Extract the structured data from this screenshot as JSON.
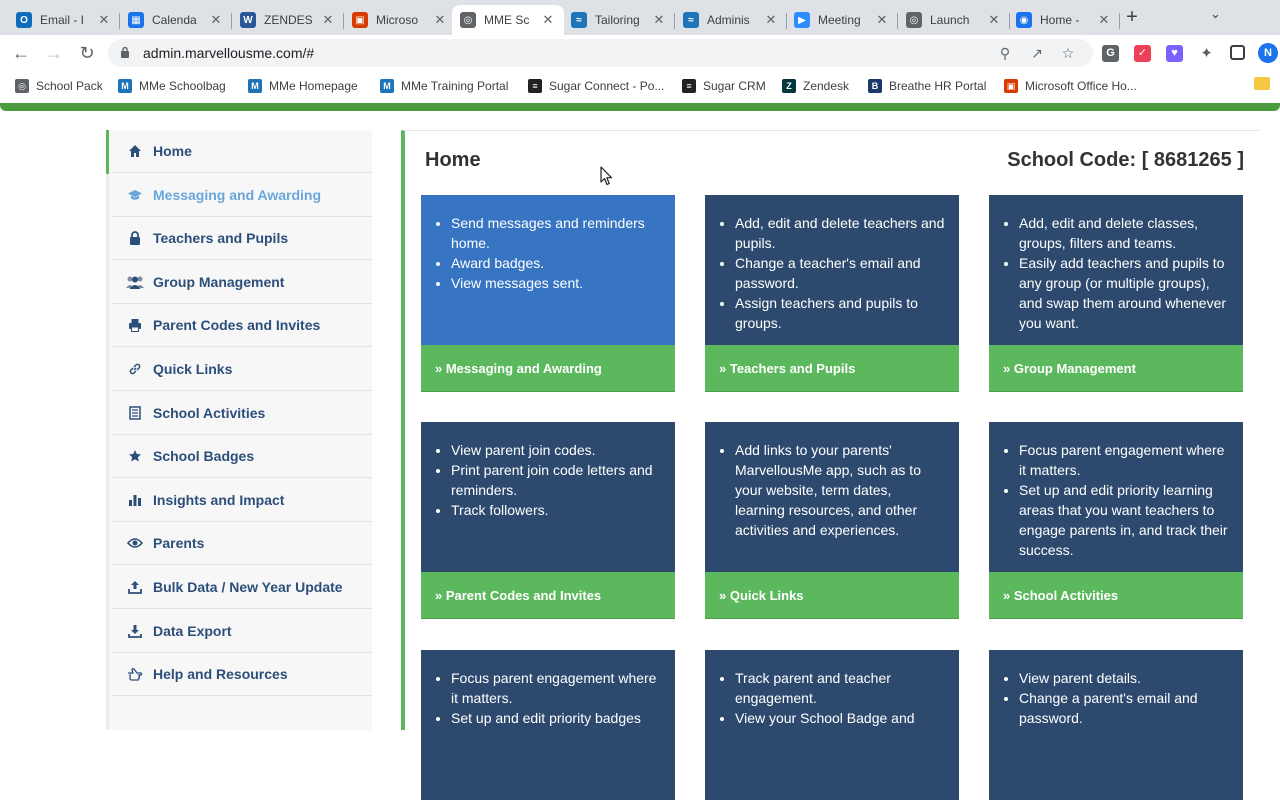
{
  "browser": {
    "tabs": [
      {
        "label": "Email - I",
        "icon": "outlook-icon",
        "color": "#0f6cbd"
      },
      {
        "label": "Calenda",
        "icon": "calendar-icon",
        "color": "#1a73e8"
      },
      {
        "label": "ZENDES",
        "icon": "word-icon",
        "color": "#2b579a"
      },
      {
        "label": "Microso",
        "icon": "office-icon",
        "color": "#d83b01"
      },
      {
        "label": "MME Sc",
        "icon": "globe-icon",
        "color": "#5f6368",
        "active": true
      },
      {
        "label": "Tailoring",
        "icon": "zendesk-guide-icon",
        "color": "#1f73b7"
      },
      {
        "label": "Adminis",
        "icon": "zendesk-guide-icon",
        "color": "#1f73b7"
      },
      {
        "label": "Meeting",
        "icon": "zoom-icon",
        "color": "#2d8cff"
      },
      {
        "label": "Launch",
        "icon": "globe-icon",
        "color": "#5f6368"
      },
      {
        "label": "Home -",
        "icon": "chrome-icon",
        "color": "#1a73e8"
      }
    ],
    "url": "admin.marvellousme.com/#",
    "bookmarks": [
      {
        "label": "School Pack",
        "icon": "globe-icon",
        "color": "#5f6368"
      },
      {
        "label": "MMe Schoolbag",
        "icon": "mme-icon",
        "color": "#1f73b7"
      },
      {
        "label": "MMe Homepage",
        "icon": "mme-icon",
        "color": "#1f73b7"
      },
      {
        "label": "MMe Training Portal",
        "icon": "mme-icon",
        "color": "#1f73b7"
      },
      {
        "label": "Sugar Connect - Po...",
        "icon": "sugar-icon",
        "color": "#222222"
      },
      {
        "label": "Sugar CRM",
        "icon": "sugar-icon",
        "color": "#222222"
      },
      {
        "label": "Zendesk",
        "icon": "zendesk-icon",
        "color": "#03363d"
      },
      {
        "label": "Breathe HR Portal",
        "icon": "breathe-icon",
        "color": "#1b3a6b"
      },
      {
        "label": "Microsoft Office Ho...",
        "icon": "office-icon",
        "color": "#d83b01"
      }
    ],
    "accent_green": "#4b9a3e"
  },
  "sidebar": {
    "items": [
      {
        "label": "Home",
        "icon": "home-icon",
        "active": true
      },
      {
        "label": "Messaging and Awarding",
        "icon": "graduation-cap-icon",
        "light": true
      },
      {
        "label": "Teachers and Pupils",
        "icon": "lock-icon"
      },
      {
        "label": "Group Management",
        "icon": "group-icon"
      },
      {
        "label": "Parent Codes and Invites",
        "icon": "print-icon"
      },
      {
        "label": "Quick Links",
        "icon": "link-icon"
      },
      {
        "label": "School Activities",
        "icon": "list-icon"
      },
      {
        "label": "School Badges",
        "icon": "star-icon"
      },
      {
        "label": "Insights and Impact",
        "icon": "bar-chart-icon"
      },
      {
        "label": "Parents",
        "icon": "eye-icon"
      },
      {
        "label": "Bulk Data / New Year Update",
        "icon": "upload-icon"
      },
      {
        "label": "Data Export",
        "icon": "download-icon"
      },
      {
        "label": "Help and Resources",
        "icon": "hand-pointer-icon"
      }
    ]
  },
  "main": {
    "title": "Home",
    "school_code": "School Code: [ 8681265 ]",
    "cards": [
      {
        "bullets": [
          "Send messages and reminders home.",
          "Award badges.",
          "View messages sent."
        ],
        "link": "» Messaging and Awarding",
        "style": "blue"
      },
      {
        "bullets": [
          "Add, edit and delete teachers and pupils.",
          "Change a teacher's email and password.",
          "Assign teachers and pupils to groups."
        ],
        "link": "» Teachers and Pupils",
        "style": "navy"
      },
      {
        "bullets": [
          "Add, edit and delete classes, groups, filters and teams.",
          "Easily add teachers and pupils to any group (or multiple groups), and swap them around whenever you want."
        ],
        "link": "» Group Management",
        "style": "navy"
      },
      {
        "bullets": [
          "View parent join codes.",
          "Print parent join code letters and reminders.",
          "Track followers."
        ],
        "link": "» Parent Codes and Invites",
        "style": "navy"
      },
      {
        "bullets": [
          "Add links to your parents' MarvellousMe app, such as to your website, term dates, learning resources, and other activities and experiences."
        ],
        "link": "» Quick Links",
        "style": "navy"
      },
      {
        "bullets": [
          "Focus parent engagement where it matters.",
          "Set up and edit priority learning areas that you want teachers to engage parents in, and track their success."
        ],
        "link": "» School Activities",
        "style": "navy"
      },
      {
        "bullets": [
          "Focus parent engagement where it matters.",
          "Set up and edit priority badges"
        ],
        "link": "",
        "style": "navy"
      },
      {
        "bullets": [
          "Track parent and teacher engagement.",
          "View your School Badge and"
        ],
        "link": "",
        "style": "navy"
      },
      {
        "bullets": [
          "View parent details.",
          "Change a parent's email and password."
        ],
        "link": "",
        "style": "navy"
      }
    ]
  }
}
